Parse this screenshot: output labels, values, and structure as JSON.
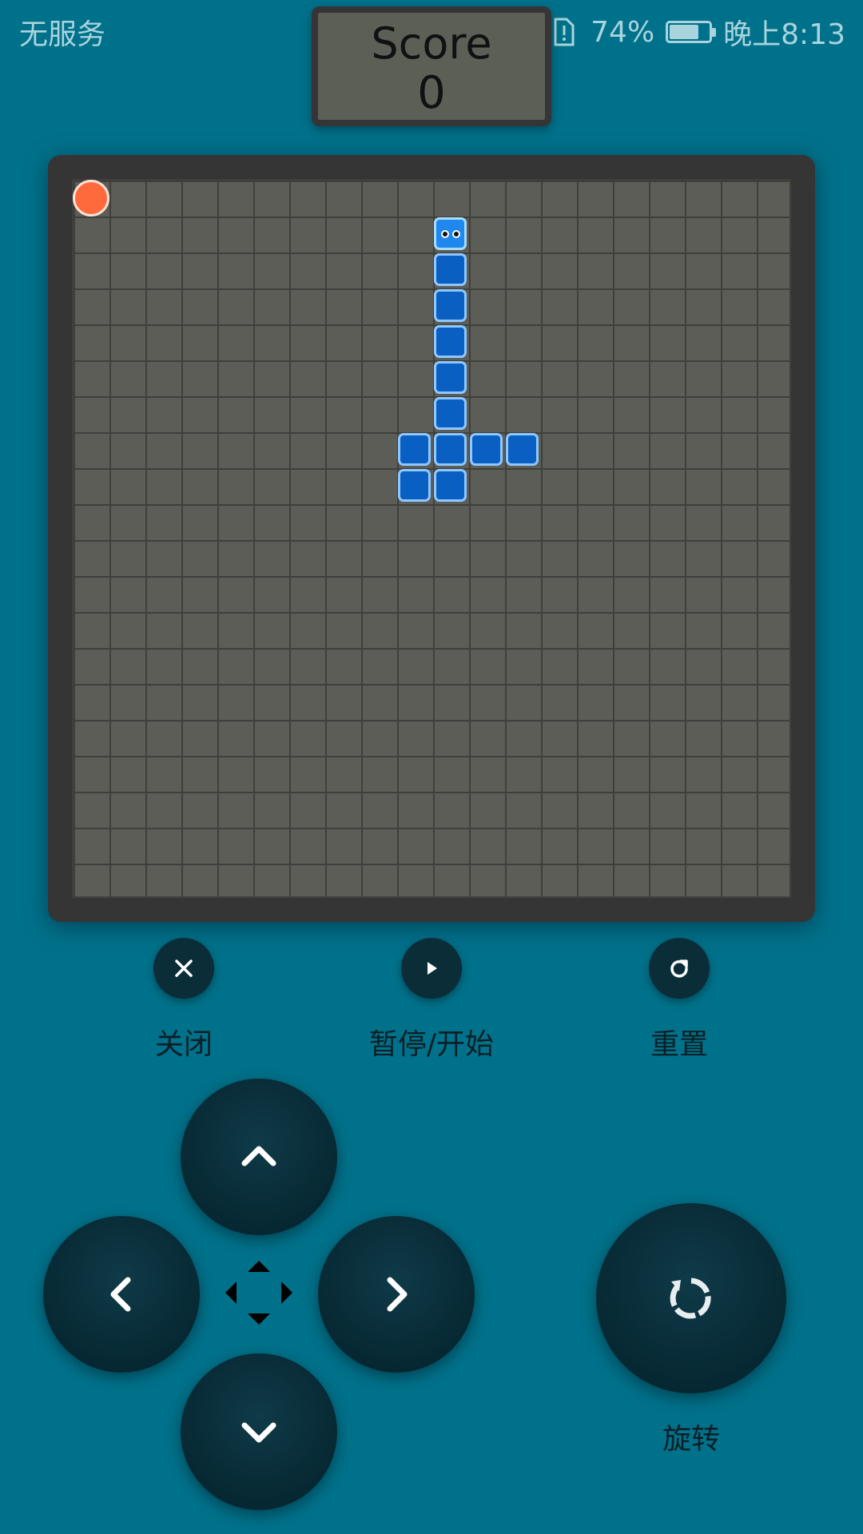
{
  "status_bar": {
    "carrier": "无服务",
    "battery_percent": "74%",
    "battery_level": 0.74,
    "time": "晚上8:13",
    "icons": [
      "mute-icon",
      "eye-comfort-icon",
      "wifi-icon",
      "sim-alert-icon",
      "battery-icon"
    ]
  },
  "score": {
    "label": "Score",
    "value": "0"
  },
  "board": {
    "columns": 20,
    "rows": 20,
    "food": {
      "col": 0,
      "row": 0,
      "color": "#ff6a3d"
    },
    "snake_head": {
      "col": 10,
      "row": 1
    },
    "snake_body": [
      {
        "col": 10,
        "row": 2
      },
      {
        "col": 10,
        "row": 3
      },
      {
        "col": 10,
        "row": 4
      },
      {
        "col": 10,
        "row": 5
      },
      {
        "col": 10,
        "row": 6
      },
      {
        "col": 9,
        "row": 7
      },
      {
        "col": 10,
        "row": 7
      },
      {
        "col": 11,
        "row": 7
      },
      {
        "col": 12,
        "row": 7
      },
      {
        "col": 9,
        "row": 8
      },
      {
        "col": 10,
        "row": 8
      }
    ],
    "snake_color": "#0a5fc2"
  },
  "controls": {
    "close_label": "关闭",
    "pause_label": "暂停/开始",
    "reset_label": "重置",
    "rotate_label": "旋转"
  },
  "colors": {
    "background": "#00718a",
    "board": "#5b5d56",
    "frame": "#353535",
    "button": "#0b2d38"
  }
}
